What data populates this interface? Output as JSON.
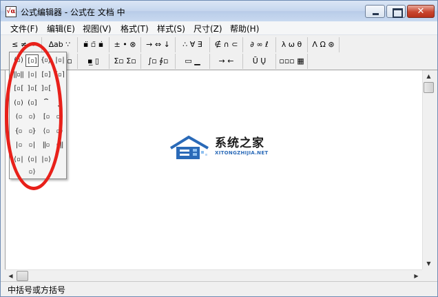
{
  "window": {
    "title": "公式编辑器 - 公式在 文档 中",
    "close_glyph": "✕"
  },
  "menubar": {
    "items": [
      {
        "label": "文件(F)"
      },
      {
        "label": "编辑(E)"
      },
      {
        "label": "视图(V)"
      },
      {
        "label": "格式(T)"
      },
      {
        "label": "样式(S)"
      },
      {
        "label": "尺寸(Z)"
      },
      {
        "label": "帮助(H)"
      }
    ]
  },
  "toolbar": {
    "row1": [
      {
        "label": "≤ ≠ ≈"
      },
      {
        "label": "∆ab ∵"
      },
      {
        "label": "▪̈ ▫̈ ▪̇"
      },
      {
        "label": "± • ⊗"
      },
      {
        "label": "→ ⇔ ↓"
      },
      {
        "label": "∴ ∀ ∃"
      },
      {
        "label": "∉ ∩ ⊂"
      },
      {
        "label": "∂ ∞ ℓ"
      },
      {
        "label": "λ ω θ"
      },
      {
        "label": "Λ Ω ⊛"
      }
    ],
    "row2": [
      {
        "label": "(▫) [▫]"
      },
      {
        "label": "▫/▫ √▫"
      },
      {
        "label": "▪̲ ▯"
      },
      {
        "label": "Σ▫ Σ▫"
      },
      {
        "label": "∫▫ ∮▫"
      },
      {
        "label": "▭ ▁"
      },
      {
        "label": "→ ←"
      },
      {
        "label": "Ū Ų"
      },
      {
        "label": "▫▫▫ ▦"
      }
    ]
  },
  "palette": {
    "selected_index": 1,
    "items": [
      "(▫)",
      "[▫]",
      "{▫}",
      "|▫|",
      "‖▫‖",
      "|▫|",
      "[▫]",
      "⌈▫⌉",
      "[▫[",
      "]▫[",
      "]▫[",
      "",
      "(▫)",
      "(▫]",
      "⏞",
      "⏟",
      "(▫",
      "▫)",
      "[▫",
      "▫]",
      "{▫",
      "▫}",
      "⟨▫",
      "▫⟩",
      "|▫",
      "▫|",
      "‖▫",
      "▫‖",
      "⟨▫|",
      "⟨▫|▫⟩",
      "|▫⟩",
      ""
    ]
  },
  "watermark": {
    "name": "系统之家",
    "url": "XITONGZHIJIA.NET"
  },
  "statusbar": {
    "text": "中括号或方括号"
  },
  "scroll": {
    "up": "▲",
    "down": "▼",
    "left": "◀",
    "right": "▶"
  },
  "colors": {
    "highlight_ring": "#e8201a",
    "logo_blue": "#2a6ab8"
  }
}
